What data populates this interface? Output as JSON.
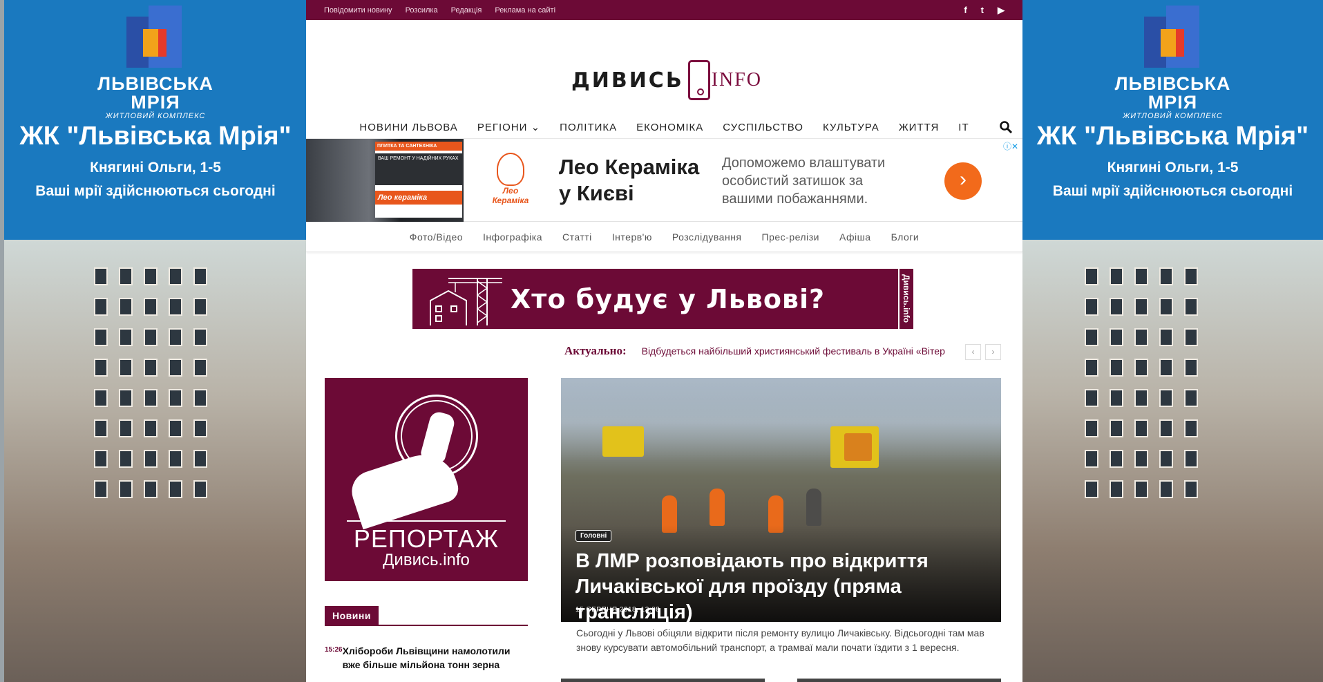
{
  "skin": {
    "brand": "ЛЬВІВСЬКА МРІЯ",
    "brand_sub": "ЖИТЛОВИЙ КОМПЛЕКС",
    "title": "ЖК \"Львівська Мрія\"",
    "address": "Княгині Ольги, 1-5",
    "slogan": "Ваші мрії здійснюються сьогодні"
  },
  "topbar": {
    "links": [
      "Повідомити новину",
      "Розсилка",
      "Редакція",
      "Реклама на сайті"
    ],
    "social": [
      "f",
      "t",
      "▶"
    ]
  },
  "logo": {
    "word1": "ДИВИСЬ",
    "word2": "INFO"
  },
  "nav": {
    "items": [
      "НОВИНИ ЛЬВОВА",
      "РЕГІОНИ",
      "ПОЛІТИКА",
      "ЕКОНОМІКА",
      "СУСПІЛЬСТВО",
      "КУЛЬТУРА",
      "ЖИТТЯ",
      "IT"
    ],
    "regions_chevron": "⌄"
  },
  "ad": {
    "card_top": "ПЛИТКА ТА САНТЕХНІКА",
    "card_mid": "ВАШ РЕМОНТ У НАДІЙНИХ РУКАХ",
    "card_brand": "Лео кераміка",
    "brand_name": "Лео Кераміка",
    "title_line1": "Лео Кераміка",
    "title_line2": "у Києві",
    "description": "Допоможемо влаштувати особистий затишок за вашими побажаннями.",
    "button": "›",
    "info": "ⓘ✕"
  },
  "subnav": [
    "Фото/Відео",
    "Інфографіка",
    "Статті",
    "Інтерв'ю",
    "Розслідування",
    "Прес-релізи",
    "Афіша",
    "Блоги"
  ],
  "banner": {
    "title": "Хто будує у Львові?",
    "vertical": "Дивись.info"
  },
  "ticker": {
    "label": "Актуально:",
    "text": "Відбудеться найбільший християнський фестиваль в Україні «Вітер",
    "prev": "‹",
    "next": "›"
  },
  "promo": {
    "title": "РЕПОРТАЖ",
    "subtitle": "Дивись.info"
  },
  "news": {
    "header": "Новини",
    "items": [
      {
        "time": "15:26",
        "title": "Хлібороби Львівщини намолотили вже більше мільйона тонн зерна"
      }
    ]
  },
  "hero": {
    "tag": "Головні",
    "title": "В ЛМР розповідають про відкриття Личаківської для проїзду (пряма трансляція)",
    "date": "15 СЕРПНЯ 2018, 13:08",
    "lead": "Сьогодні у Львові обіцяли відкрити після ремонту вулицю Личаківську. Відсьогодні там мав знову курсувати автомобільний транспорт, а трамваї мали почати їздити з 1 вересня."
  },
  "colors": {
    "brand": "#6c0a36",
    "skin_blue": "#1a79bf",
    "ad_orange": "#f26a1b"
  }
}
